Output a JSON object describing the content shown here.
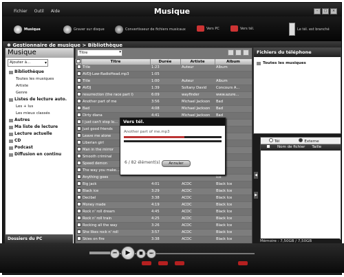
{
  "app": {
    "title": "Musique",
    "menu": [
      "Fichier",
      "Outil",
      "Aide"
    ]
  },
  "toolbar": {
    "music": "Musique",
    "burn": "Graver sur disque",
    "convert": "Convertisseur de fichiers musicaux",
    "to_pc": "Vers PC",
    "to_phone": "Vers tél.",
    "phone_status": "Le tél. est branché"
  },
  "breadcrumb": {
    "part1": "Gestionnaire de musique",
    "separator": ">",
    "part2": "Bibliothèque"
  },
  "left_panel": {
    "title": "Musique",
    "add_to": "Ajouter à...",
    "tree": [
      {
        "label": "Bibliothèque",
        "bold": true,
        "sub": false
      },
      {
        "label": "Toutes les musiques",
        "bold": false,
        "sub": true
      },
      {
        "label": "Artiste",
        "bold": false,
        "sub": true
      },
      {
        "label": "Genre",
        "bold": false,
        "sub": true
      },
      {
        "label": "Listes de lecture auto.",
        "bold": true,
        "sub": false
      },
      {
        "label": "Les + lus",
        "bold": false,
        "sub": true
      },
      {
        "label": "Les mieux classés",
        "bold": false,
        "sub": true
      },
      {
        "label": "Autres",
        "bold": true,
        "sub": false
      },
      {
        "label": "Ma liste de lecture",
        "bold": true,
        "sub": false
      },
      {
        "label": "Lecture actuelle",
        "bold": true,
        "sub": false
      },
      {
        "label": "CD",
        "bold": true,
        "sub": false
      },
      {
        "label": "Podcast",
        "bold": true,
        "sub": false
      },
      {
        "label": "Diffusion en continu",
        "bold": true,
        "sub": false
      }
    ],
    "footer": "Dossiers du PC"
  },
  "center": {
    "filter": "Titre",
    "columns": [
      "Titre",
      "Durée",
      "Artiste",
      "Album"
    ],
    "rows": [
      [
        "Title",
        "1:23",
        "Auteur",
        "Album"
      ],
      [
        "AVDJ-Law-RadioHead.mp3",
        "1:05",
        "",
        ""
      ],
      [
        "Title",
        "1:00",
        "Auteur",
        "Album"
      ],
      [
        "AVDJ",
        "1:39",
        "Soltany David",
        "Concours A..."
      ],
      [
        "resurrection (the race part I)",
        "6:09",
        "wayfinder",
        "www.azure..."
      ],
      [
        "Another part of me",
        "3:56",
        "Michael Jackson",
        "Bad"
      ],
      [
        "Bad",
        "4:08",
        "Michael Jackson",
        "Bad"
      ],
      [
        "Dirty diana",
        "4:41",
        "Michael Jackson",
        "Bad"
      ],
      [
        "I just can't stop lo...",
        "",
        "",
        ""
      ],
      [
        "Just good friends",
        "",
        "",
        ""
      ],
      [
        "Leave me alone",
        "",
        "",
        ""
      ],
      [
        "Liberian girl",
        "",
        "",
        ""
      ],
      [
        "Man in the mirror",
        "",
        "",
        ""
      ],
      [
        "Smooth criminal",
        "",
        "",
        ""
      ],
      [
        "Speed demon",
        "",
        "",
        ""
      ],
      [
        "The way you make...",
        "",
        "",
        ""
      ],
      [
        "Anything goes",
        "",
        "",
        "Ice"
      ],
      [
        "Big jack",
        "4:01",
        "ACDC",
        "Black Ice"
      ],
      [
        "Black ice",
        "3:29",
        "ACDC",
        "Black Ice"
      ],
      [
        "Decibel",
        "3:38",
        "ACDC",
        "Black Ice"
      ],
      [
        "Money made",
        "4:19",
        "ACDC",
        "Black Ice"
      ],
      [
        "Rock n' roll dream",
        "4:45",
        "ACDC",
        "Black Ice"
      ],
      [
        "Rock n' roll train",
        "4:25",
        "ACDC",
        "Black Ice"
      ],
      [
        "Rocking all the way",
        "3:26",
        "ACDC",
        "Black Ice"
      ],
      [
        "She likes rock n' roll",
        "3:57",
        "ACDC",
        "Black Ice"
      ],
      [
        "Skies on fire",
        "3:38",
        "ACDC",
        "Black Ice"
      ],
      [
        "Smash n' grab",
        "4:10",
        "ACDC",
        "Black Ice"
      ]
    ]
  },
  "dialog": {
    "title": "Vers tél.",
    "file": "Another part of me.mp3",
    "progress": 0.62,
    "count": "6 / 82 élément(s)",
    "cancel": "Annuler"
  },
  "right_panel": {
    "title": "Fichiers du téléphone",
    "item": "Toutes les musiques",
    "radio_phone": "Tél",
    "radio_external": "Externe",
    "col_name": "Nom de fichier",
    "col_size": "Taille",
    "memory": "Mémoire : 7,50GB / 7,50GB"
  }
}
